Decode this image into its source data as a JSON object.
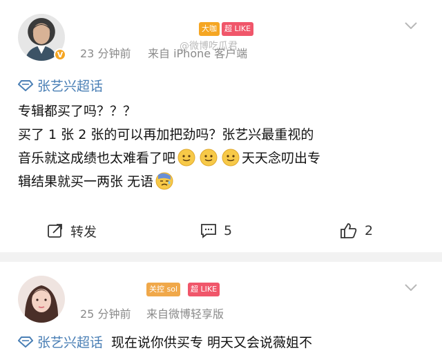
{
  "posts": [
    {
      "badge_level": "大咖",
      "badge_like": "超 LIKE",
      "time": "23 分钟前",
      "source": "来自 iPhone 客户端",
      "topic": "张艺兴超话",
      "lines": [
        "专辑都买了吗？？？",
        "买了 1 张 2 张的可以再加把劲吗？张艺兴最重视的",
        "音乐就这成绩也太难看了吧",
        "天天念叨出专",
        "辑结果就买一两张 无语"
      ],
      "actions": {
        "repost": "转发",
        "comments": "5",
        "likes": "2"
      },
      "watermark": "@微博吃瓜君"
    },
    {
      "badge_level": "关控 sol",
      "badge_like": "超 LIKE",
      "time": "25 分钟前",
      "source": "来自微博轻享版",
      "topic": "张艺兴超话",
      "preview": "现在说你供买专 明天又会说薇姐不"
    }
  ],
  "colors": {
    "topic": "#4a7fb5",
    "meta": "#8a8a8a",
    "badge_level": "#f5a623",
    "badge_like": "#f0566a",
    "divider": "#f2f2f2"
  },
  "icons": [
    "diamond-topic-icon",
    "repost-icon",
    "comment-icon",
    "like-icon",
    "chevron-down-icon",
    "smile-emoji-icon",
    "sweat-emoji-icon",
    "verified-icon"
  ]
}
